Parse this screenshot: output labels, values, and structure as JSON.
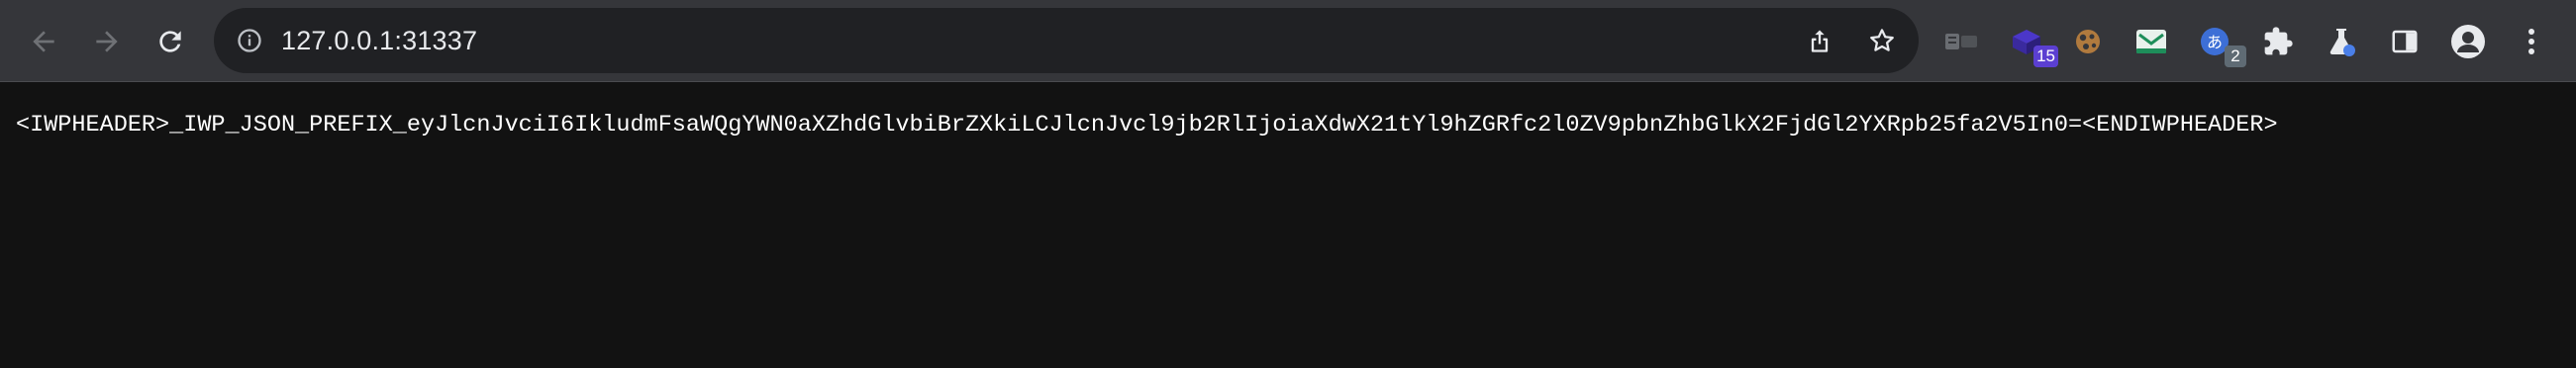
{
  "browser": {
    "omnibox": {
      "url": "127.0.0.1:31337"
    },
    "extensions": [
      {
        "name": "extension-chip",
        "badge": ""
      },
      {
        "name": "extension-cube",
        "badge": "15",
        "badge_color": "#5b3fd1"
      },
      {
        "name": "extension-cookie",
        "badge": ""
      },
      {
        "name": "extension-mail",
        "badge": ""
      },
      {
        "name": "extension-translate",
        "badge": "2",
        "badge_color": "#5f6b74"
      },
      {
        "name": "extensions-puzzle",
        "badge": ""
      },
      {
        "name": "extension-flask",
        "badge": ""
      }
    ],
    "icons": {
      "back": "arrow-left-icon",
      "forward": "arrow-right-icon",
      "reload": "reload-icon",
      "site_info": "site-info-icon",
      "share": "share-icon",
      "bookmark": "star-icon",
      "side_panel": "side-panel-icon",
      "profile": "profile-icon",
      "menu": "kebab-menu-icon"
    },
    "colors": {
      "toolbar_bg": "#35363a",
      "omnibox_bg": "#202124",
      "page_bg": "#121212",
      "page_text": "#ffffff"
    }
  },
  "page": {
    "text": "<IWPHEADER>_IWP_JSON_PREFIX_eyJlcnJvciI6IkludmFsaWQgYWN0aXZhdGlvbiBrZXkiLCJlcnJvcl9jb2RlIjoiaXdwX21tYl9hZGRfc2l0ZV9pbnZhbGlkX2FjdGl2YXRpb25fa2V5In0=<ENDIWPHEADER>"
  }
}
